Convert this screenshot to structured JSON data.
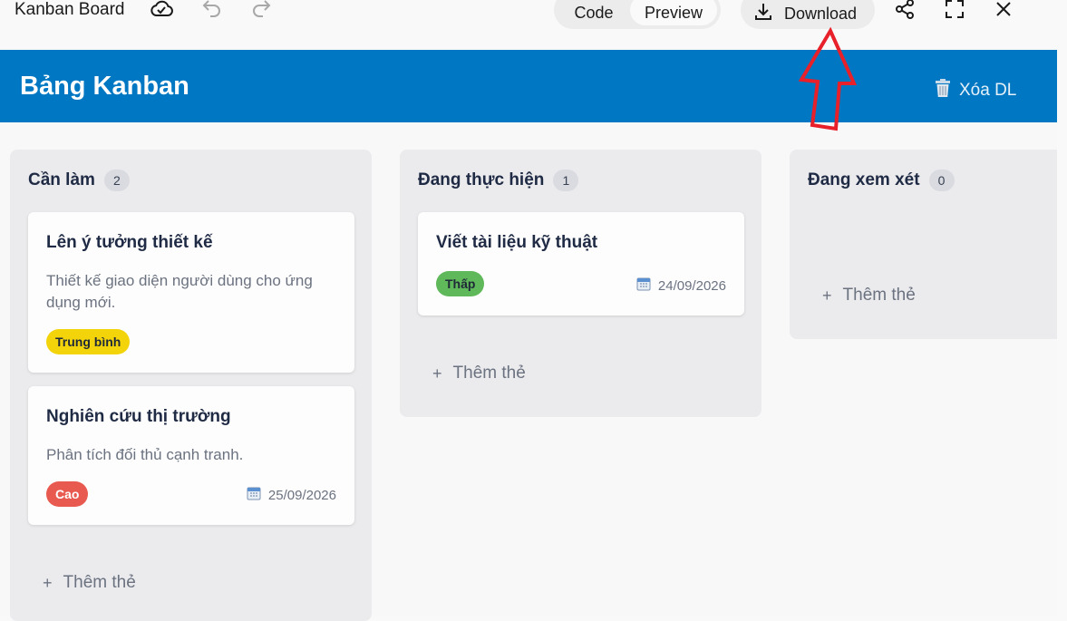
{
  "topbar": {
    "app_title": "Kanban Board",
    "tabs": {
      "code": "Code",
      "preview": "Preview"
    },
    "download_label": "Download"
  },
  "board": {
    "title": "Bảng Kanban",
    "clear_label": "Xóa DL",
    "columns": [
      {
        "title": "Cần làm",
        "count": "2",
        "cards": [
          {
            "title": "Lên ý tưởng thiết kế",
            "description": "Thiết kế giao diện người dùng cho ứng dụng mới.",
            "priority": "Trung bình",
            "due": ""
          },
          {
            "title": "Nghiên cứu thị trường",
            "description": "Phân tích đối thủ cạnh tranh.",
            "priority": "Cao",
            "due": "25/09/2026"
          }
        ],
        "add_label": "Thêm thẻ"
      },
      {
        "title": "Đang thực hiện",
        "count": "1",
        "cards": [
          {
            "title": "Viết tài liệu kỹ thuật",
            "description": "",
            "priority": "Thấp",
            "due": "24/09/2026"
          }
        ],
        "add_label": "Thêm thẻ"
      },
      {
        "title": "Đang xem xét",
        "count": "0",
        "cards": [],
        "add_label": "Thêm thẻ"
      }
    ]
  },
  "icons": {
    "cloud": "cloud-check-icon",
    "undo": "undo-icon",
    "redo": "redo-icon",
    "download": "download-icon",
    "share": "share-icon",
    "fullscreen": "fullscreen-icon",
    "close": "close-icon",
    "trash": "trash-icon",
    "calendar": "calendar-icon"
  },
  "colors": {
    "header_bg": "#0077c2",
    "priority_medium": "#f3d40b",
    "priority_high": "#e85a4f",
    "priority_low": "#5fb85a",
    "annotation_arrow": "#e8202a"
  }
}
